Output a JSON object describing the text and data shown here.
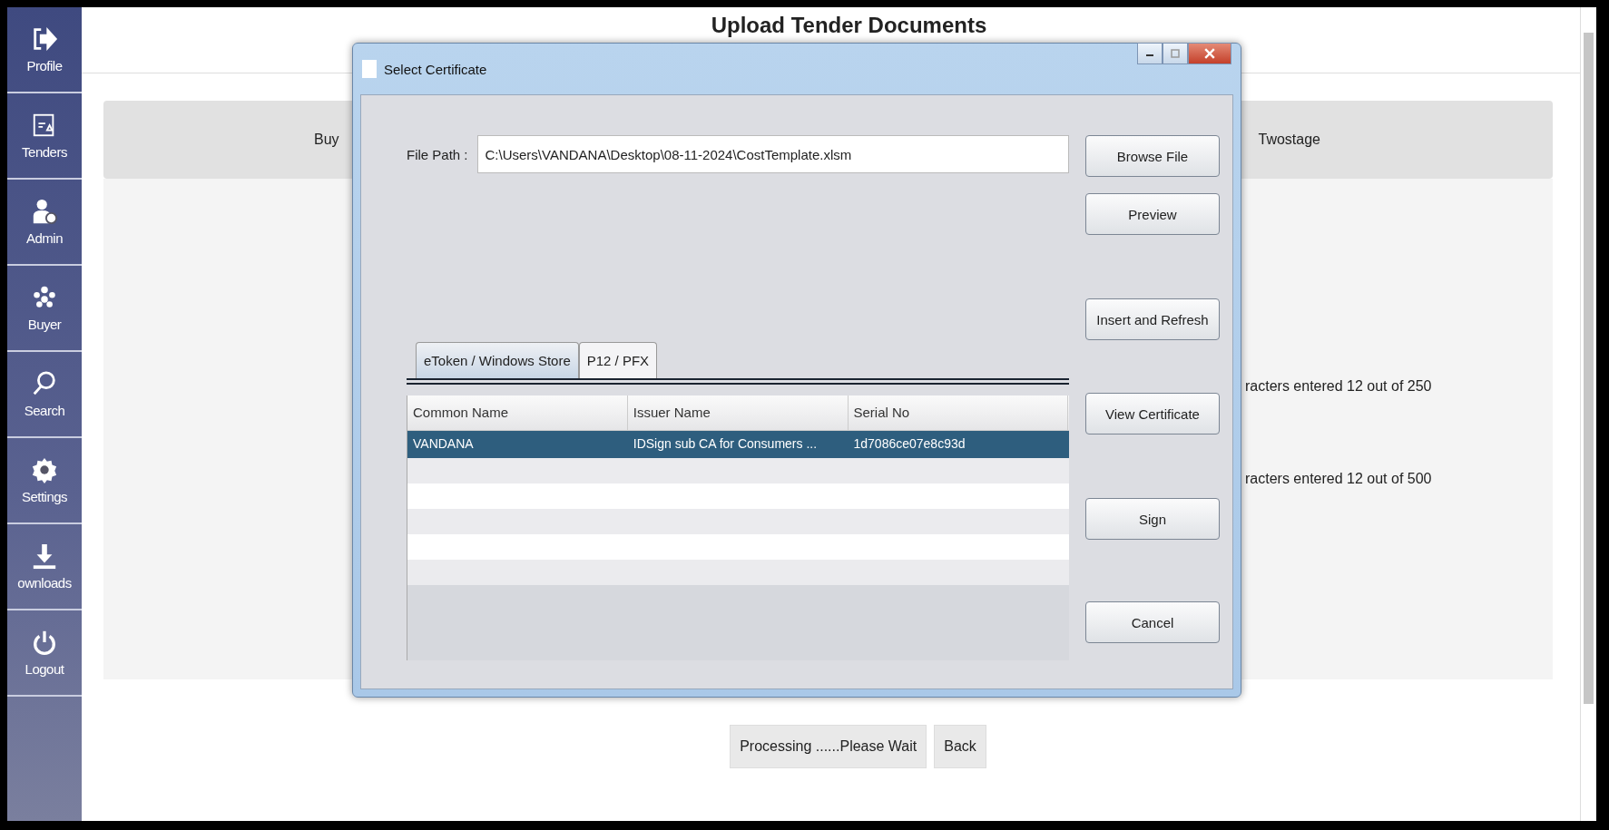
{
  "sidebar": {
    "items": [
      {
        "kind": "profile",
        "label": "Profile"
      },
      {
        "kind": "tenders",
        "label": "Tenders"
      },
      {
        "kind": "admin",
        "label": "Admin"
      },
      {
        "kind": "buyer",
        "label": "Buyer"
      },
      {
        "kind": "search",
        "label": "Search"
      },
      {
        "kind": "settings",
        "label": "Settings"
      },
      {
        "kind": "downloads",
        "label": "ownloads"
      },
      {
        "kind": "logout",
        "label": "Logout"
      }
    ]
  },
  "page": {
    "title": "Upload Tender Documents",
    "info_band": {
      "left_text": "Buy",
      "right_text": "Twostage"
    },
    "counters": [
      "racters entered 12 out of 250",
      "racters entered 12 out of 500"
    ],
    "buttons": [
      "Processing ......Please Wait",
      "Back"
    ]
  },
  "dialog": {
    "title": "Select Certificate",
    "file_path": {
      "label": "File Path :",
      "value": "C:\\Users\\VANDANA\\Desktop\\08-11-2024\\CostTemplate.xlsm"
    },
    "tabs": [
      {
        "label": "eToken / Windows Store",
        "selected": true
      },
      {
        "label": "P12 / PFX",
        "selected": false
      }
    ],
    "table": {
      "columns": [
        "Common Name",
        "Issuer Name",
        "Serial No"
      ],
      "rows": [
        {
          "cells": [
            "VANDANA",
            "IDSign sub CA for Consumers ...",
            "1d7086ce07e8c93d"
          ],
          "selected": true
        }
      ]
    },
    "buttons": [
      "Browse File",
      "Preview",
      "Insert and Refresh",
      "View Certificate",
      "Sign",
      "Cancel"
    ]
  }
}
